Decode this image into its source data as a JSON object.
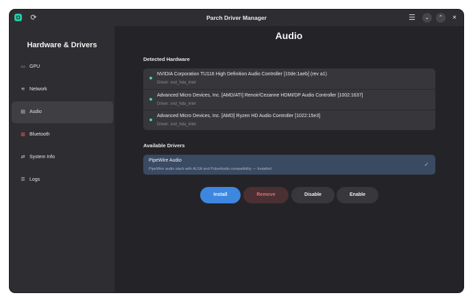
{
  "window": {
    "title": "Parch Driver Manager",
    "accent_color": "#3d87e0"
  },
  "titlebar": {
    "app_icon": "app-icon",
    "refresh_icon": "refresh-icon",
    "refresh_glyph": "⟳",
    "menu_icon": "hamburger-menu-icon",
    "menu_glyph": "☰",
    "minimize_glyph": "⌄",
    "maximize_glyph": "⌃",
    "close_glyph": "✕"
  },
  "sidebar": {
    "title": "Hardware & Drivers",
    "items": [
      {
        "label": "GPU",
        "icon": "monitor-icon",
        "glyph": "▭",
        "color": "#7fb3d8",
        "active": false
      },
      {
        "label": "Network",
        "icon": "wifi-icon",
        "glyph": "≋",
        "color": "#cfcfd4",
        "active": false
      },
      {
        "label": "Audio",
        "icon": "audio-card-icon",
        "glyph": "▤",
        "color": "#cfcfd4",
        "active": true
      },
      {
        "label": "Bluetooth",
        "icon": "bluetooth-icon",
        "glyph": "▩",
        "color": "#d04a4a",
        "active": false
      },
      {
        "label": "System Info",
        "icon": "swap-arrows-icon",
        "glyph": "⇄",
        "color": "#cfcfd4",
        "active": false
      },
      {
        "label": "Logs",
        "icon": "list-icon",
        "glyph": "☰",
        "color": "#cfcfd4",
        "active": false
      }
    ]
  },
  "main": {
    "title": "Audio",
    "detected_hardware": {
      "heading": "Detected Hardware",
      "items": [
        {
          "name": "NVIDIA Corporation TU116 High Definition Audio Controller [10de:1aeb] (rev a1)",
          "driver": "Driver: snd_hda_intel"
        },
        {
          "name": "Advanced Micro Devices, Inc. [AMD/ATI] Renoir/Cezanne HDMI/DP Audio Controller [1002:1637]",
          "driver": "Driver: snd_hda_intel"
        },
        {
          "name": "Advanced Micro Devices, Inc. [AMD] Ryzen HD Audio Controller [1022:15e3]",
          "driver": "Driver: snd_hda_intel"
        }
      ]
    },
    "available_drivers": {
      "heading": "Available Drivers",
      "items": [
        {
          "name": "PipeWire Audio",
          "description": "PipeWire audio stack with ALSA and PulseAudio compatibility — Installed",
          "check_glyph": "✓",
          "selected": true
        }
      ]
    },
    "actions": {
      "install": "Install",
      "remove": "Remove",
      "disable": "Disable",
      "enable": "Enable"
    }
  }
}
